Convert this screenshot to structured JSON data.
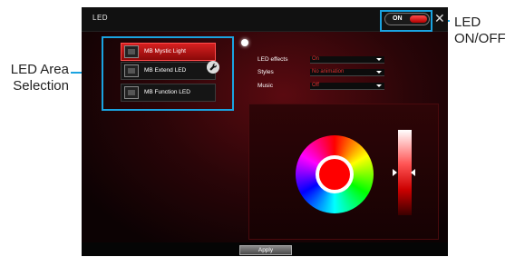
{
  "window": {
    "title": "LED",
    "power_toggle_label": "ON",
    "close_glyph": "✕"
  },
  "led_areas": [
    {
      "label": "MB Mystic Light",
      "active": true
    },
    {
      "label": "MB Extend LED",
      "active": false
    },
    {
      "label": "MB Function LED",
      "active": false
    }
  ],
  "settings": [
    {
      "label": "LED effects",
      "value": "On"
    },
    {
      "label": "Styles",
      "value": "No animation"
    },
    {
      "label": "Music",
      "value": "Off"
    }
  ],
  "color": {
    "selected": "#ff0000"
  },
  "bottom": {
    "apply_label": "Apply"
  },
  "annotations": {
    "led_area_selection": "LED Area\nSelection",
    "led_on_off": "LED\nON/OFF"
  },
  "colors": {
    "accent": "#e33030",
    "callout": "#1aa3e0"
  },
  "icons": {
    "wrench": "wrench-icon",
    "gear": "gear-icon",
    "close": "close-icon",
    "chevron": "chevron-down-icon"
  }
}
